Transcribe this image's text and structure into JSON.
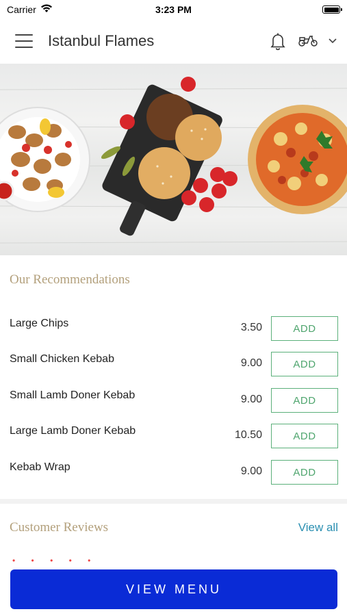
{
  "status_bar": {
    "carrier": "Carrier",
    "time": "3:23 PM"
  },
  "header": {
    "title": "Istanbul Flames"
  },
  "recommendations": {
    "title": "Our Recommendations",
    "items": [
      {
        "name": "Large Chips",
        "price": "3.50",
        "button": "ADD"
      },
      {
        "name": "Small Chicken Kebab",
        "price": "9.00",
        "button": "ADD"
      },
      {
        "name": "Small Lamb Doner Kebab",
        "price": "9.00",
        "button": "ADD"
      },
      {
        "name": "Large Lamb Doner Kebab",
        "price": "10.50",
        "button": "ADD"
      },
      {
        "name": "Kebab Wrap",
        "price": "9.00",
        "button": "ADD"
      }
    ]
  },
  "reviews": {
    "title": "Customer Reviews",
    "view_all": "View all"
  },
  "footer": {
    "view_menu": "VIEW MENU"
  },
  "colors": {
    "accent_gold": "#b3a07c",
    "add_green": "#4fa56e",
    "link_blue": "#2a8fb1",
    "primary_button": "#0a2bd6"
  },
  "icons": [
    "wifi-icon",
    "battery-icon",
    "hamburger-menu-icon",
    "bell-icon",
    "scooter-icon",
    "chevron-down-icon"
  ]
}
